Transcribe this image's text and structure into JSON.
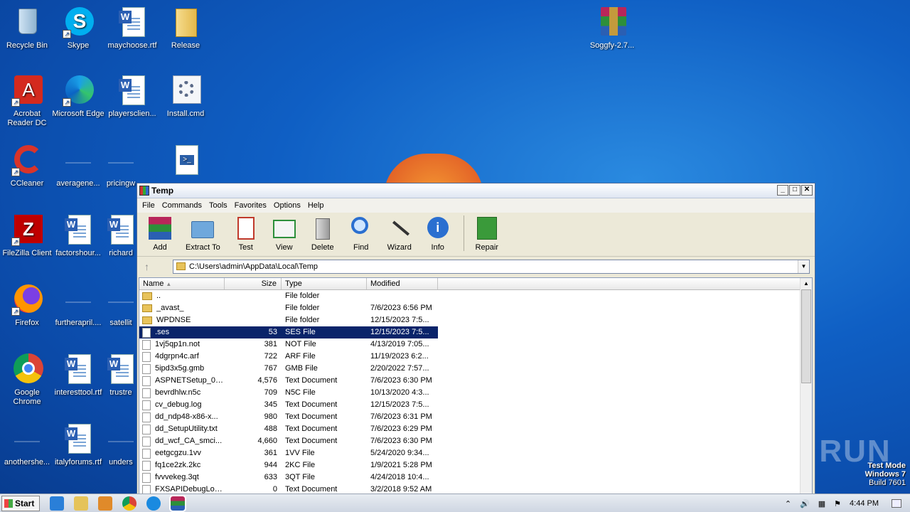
{
  "desktop": {
    "icons": [
      {
        "label": "Recycle Bin"
      },
      {
        "label": "Skype"
      },
      {
        "label": "maychoose.rtf"
      },
      {
        "label": "Release"
      },
      {
        "label": "Acrobat Reader DC"
      },
      {
        "label": "Microsoft Edge"
      },
      {
        "label": "playersclien..."
      },
      {
        "label": "Install.cmd"
      },
      {
        "label": "CCleaner"
      },
      {
        "label": "averagene..."
      },
      {
        "label": "pricingw"
      },
      {
        "label": "FileZilla Client"
      },
      {
        "label": "factorshour..."
      },
      {
        "label": "richard"
      },
      {
        "label": "Firefox"
      },
      {
        "label": "furtherapril...."
      },
      {
        "label": "satellit"
      },
      {
        "label": "Google Chrome"
      },
      {
        "label": "interesttool.rtf"
      },
      {
        "label": "trustre"
      },
      {
        "label": "anothershe..."
      },
      {
        "label": "italyforums.rtf"
      },
      {
        "label": "unders"
      },
      {
        "label": "Soggfy-2.7..."
      }
    ]
  },
  "window": {
    "title": "Temp",
    "menu": [
      "File",
      "Commands",
      "Tools",
      "Favorites",
      "Options",
      "Help"
    ],
    "toolbar": [
      "Add",
      "Extract To",
      "Test",
      "View",
      "Delete",
      "Find",
      "Wizard",
      "Info",
      "Repair"
    ],
    "address": "C:\\Users\\admin\\AppData\\Local\\Temp",
    "columns": {
      "name": "Name",
      "size": "Size",
      "type": "Type",
      "modified": "Modified"
    },
    "files": [
      {
        "name": "..",
        "size": "",
        "type": "File folder",
        "modified": "",
        "folder": true
      },
      {
        "name": "_avast_",
        "size": "",
        "type": "File folder",
        "modified": "7/6/2023 6:56 PM",
        "folder": true
      },
      {
        "name": "WPDNSE",
        "size": "",
        "type": "File folder",
        "modified": "12/15/2023 7:5...",
        "folder": true
      },
      {
        "name": ".ses",
        "size": "53",
        "type": "SES File",
        "modified": "12/15/2023 7:5...",
        "selected": true
      },
      {
        "name": "1vj5qp1n.not",
        "size": "381",
        "type": "NOT File",
        "modified": "4/13/2019 7:05..."
      },
      {
        "name": "4dgrpn4c.arf",
        "size": "722",
        "type": "ARF File",
        "modified": "11/19/2023 6:2..."
      },
      {
        "name": "5ipd3x5g.gmb",
        "size": "767",
        "type": "GMB File",
        "modified": "2/20/2022 7:57..."
      },
      {
        "name": "ASPNETSetup_00...",
        "size": "4,576",
        "type": "Text Document",
        "modified": "7/6/2023 6:30 PM"
      },
      {
        "name": "bevrdhlw.n5c",
        "size": "709",
        "type": "N5C File",
        "modified": "10/13/2020 4:3..."
      },
      {
        "name": "cv_debug.log",
        "size": "345",
        "type": "Text Document",
        "modified": "12/15/2023 7:5..."
      },
      {
        "name": "dd_ndp48-x86-x...",
        "size": "980",
        "type": "Text Document",
        "modified": "7/6/2023 6:31 PM"
      },
      {
        "name": "dd_SetupUtility.txt",
        "size": "488",
        "type": "Text Document",
        "modified": "7/6/2023 6:29 PM"
      },
      {
        "name": "dd_wcf_CA_smci...",
        "size": "4,660",
        "type": "Text Document",
        "modified": "7/6/2023 6:30 PM"
      },
      {
        "name": "eetgcgzu.1vv",
        "size": "361",
        "type": "1VV File",
        "modified": "5/24/2020 9:34..."
      },
      {
        "name": "fq1ce2zk.2kc",
        "size": "944",
        "type": "2KC File",
        "modified": "1/9/2021 5:28 PM"
      },
      {
        "name": "fvvvekeg.3qt",
        "size": "633",
        "type": "3QT File",
        "modified": "4/24/2018 10:4..."
      },
      {
        "name": "FXSAPIDebugLog...",
        "size": "0",
        "type": "Text Document",
        "modified": "3/2/2018 9:52 AM"
      }
    ]
  },
  "taskbar": {
    "start": "Start",
    "clock": "4:44 PM"
  },
  "watermark": {
    "line1": "Test Mode",
    "line2": "Windows 7",
    "line3": "Build 7601",
    "brand": "ANY RUN"
  }
}
